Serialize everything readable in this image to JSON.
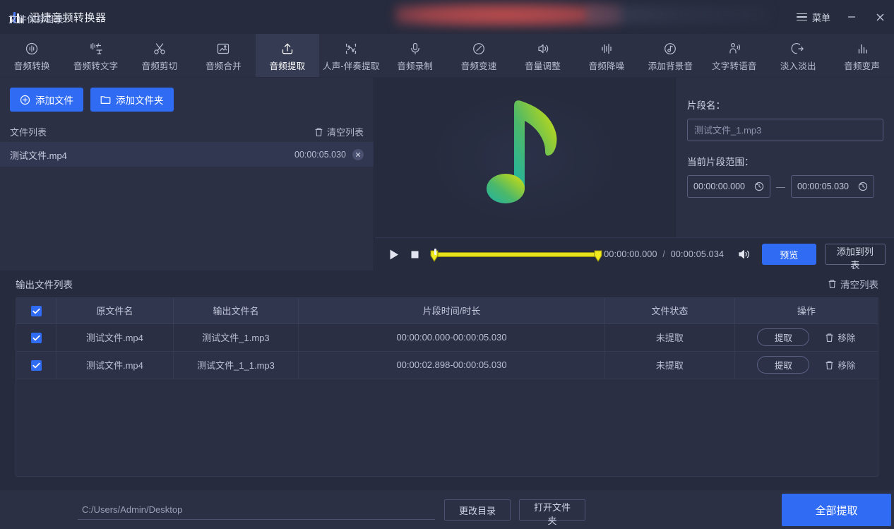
{
  "app": {
    "title": "迅捷音频转换器",
    "logo_icon": "audio-wave-logo-icon"
  },
  "titlebar": {
    "menu_label": "菜单",
    "minimize_icon": "minimize-icon",
    "close_icon": "close-icon"
  },
  "toolbar": {
    "active_index": 4,
    "items": [
      {
        "label": "音频转换",
        "icon": "audio-convert-icon"
      },
      {
        "label": "音频转文字",
        "icon": "audio-to-text-icon"
      },
      {
        "label": "音频剪切",
        "icon": "scissors-icon"
      },
      {
        "label": "音频合并",
        "icon": "merge-icon"
      },
      {
        "label": "音频提取",
        "icon": "extract-upload-icon"
      },
      {
        "label": "人声-伴奏提取",
        "icon": "vocal-separate-icon"
      },
      {
        "label": "音频录制",
        "icon": "microphone-icon"
      },
      {
        "label": "音频变速",
        "icon": "speed-clock-icon"
      },
      {
        "label": "音量调整",
        "icon": "volume-icon"
      },
      {
        "label": "音频降噪",
        "icon": "noise-reduce-icon"
      },
      {
        "label": "添加背景音",
        "icon": "background-music-icon"
      },
      {
        "label": "文字转语音",
        "icon": "text-to-speech-icon"
      },
      {
        "label": "淡入淡出",
        "icon": "fade-icon"
      },
      {
        "label": "音频变声",
        "icon": "voice-change-icon"
      }
    ]
  },
  "file_panel": {
    "add_file_label": "添加文件",
    "add_file_icon": "plus-circle-icon",
    "add_folder_label": "添加文件夹",
    "add_folder_icon": "folder-icon",
    "list_title": "文件列表",
    "clear_label": "清空列表",
    "clear_icon": "trash-icon",
    "rows": [
      {
        "name": "测试文件.mp4",
        "duration": "00:00:05.030",
        "remove_icon": "close-circle-icon"
      }
    ]
  },
  "preview": {
    "artwork_icon": "music-note-icon",
    "play_icon": "play-icon",
    "stop_icon": "stop-icon",
    "volume_icon": "speaker-icon",
    "current_time": "00:00:00.000",
    "time_separator": "/",
    "total_time": "00:00:05.034",
    "preview_label": "预览",
    "add_to_list_label": "添加到列表",
    "selection_start_pct": 0,
    "selection_end_pct": 100,
    "playhead_pct": 0
  },
  "segment": {
    "name_label": "片段名：",
    "name_placeholder": "测试文件_1.mp3",
    "name_value": "",
    "range_label": "当前片段范围：",
    "start_time": "00:00:00.000",
    "end_time": "00:00:05.030",
    "dash": "—",
    "reset_icon": "reset-clock-icon"
  },
  "output": {
    "title": "输出文件列表",
    "clear_label": "清空列表",
    "clear_icon": "trash-icon",
    "columns": [
      "",
      "原文件名",
      "输出文件名",
      "片段时间/时长",
      "文件状态",
      "操作"
    ],
    "header_checked": true,
    "rows": [
      {
        "checked": true,
        "source": "测试文件.mp4",
        "output": "测试文件_1.mp3",
        "time": "00:00:00.000-00:00:05.030",
        "status": "未提取",
        "extract_label": "提取",
        "remove_label": "移除",
        "remove_icon": "trash-icon"
      },
      {
        "checked": true,
        "source": "测试文件.mp4",
        "output": "测试文件_1_1.mp3",
        "time": "00:00:02.898-00:00:05.030",
        "status": "未提取",
        "extract_label": "提取",
        "remove_label": "移除",
        "remove_icon": "trash-icon"
      }
    ]
  },
  "footer": {
    "save_dir_label": "文件保存目录：",
    "save_dir_value": "C:/Users/Admin/Desktop",
    "change_dir_label": "更改目录",
    "open_folder_label": "打开文件夹",
    "extract_all_label": "全部提取"
  },
  "colors": {
    "accent_blue": "#2f6bf3",
    "window_bg": "#262b3d",
    "panel_bg": "#2b3045",
    "timeline_yellow": "#e8e21c",
    "note_teal": "#2bb3a3",
    "note_green": "#cddc1f"
  }
}
